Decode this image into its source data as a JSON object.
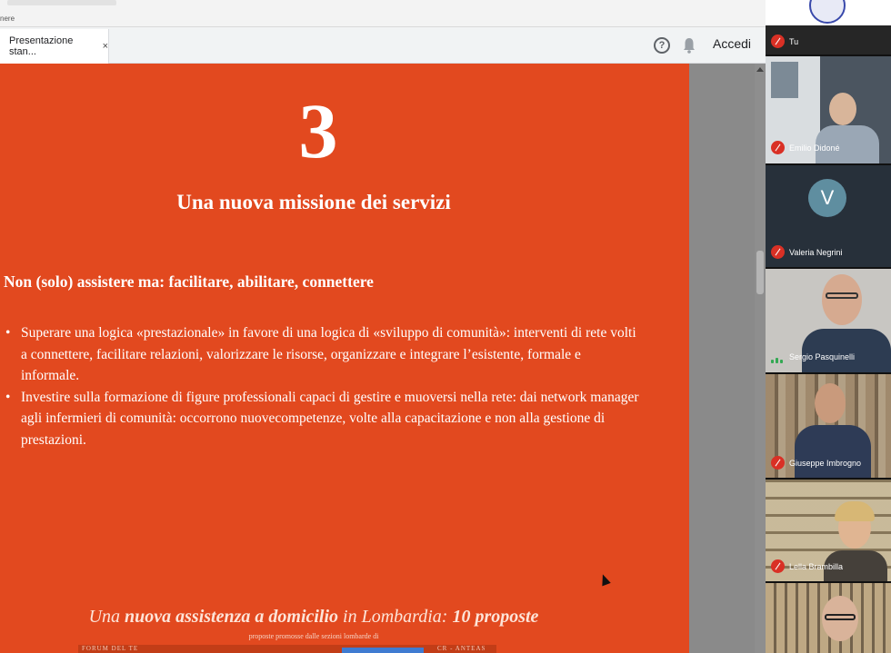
{
  "browser": {
    "menu_text": "nere"
  },
  "tab": {
    "title": "Presentazione stan...",
    "close": "×"
  },
  "toolbar": {
    "help_icon": "help-circle-icon",
    "bell_icon": "bell-icon",
    "signin_label": "Accedi"
  },
  "slide": {
    "number": "3",
    "title": "Una nuova missione dei servizi",
    "subtitle": "Non (solo) assistere ma: facilitare, abilitare, connettere",
    "bullets": [
      "Superare una logica «prestazionale» in favore di una logica di «sviluppo di comunità»: interventi di rete volti a connettere, facilitare relazioni, valorizzare le risorse, organizzare e integrare l’esistente, formale e informale.",
      "Investire sulla formazione di figure professionali capaci di gestire e muoversi nella rete: dai network manager agli infermieri di comunità: occorrono nuovecompetenze, volte alla capacitazione e non alla gestione di prestazioni."
    ],
    "footer": {
      "part1": "Una ",
      "part2": "nuova assistenza a domicilio",
      "part3": " in Lombardia: ",
      "part4": "10 proposte",
      "sub": "proposte promosse dalle sezioni lombarde di",
      "band_left": "FORUM DEL TE",
      "band_right": "CR - ANTEAS"
    }
  },
  "participants": [
    {
      "name": "Tu",
      "muted": true
    },
    {
      "name": "Emilio Didoné",
      "muted": true
    },
    {
      "name": "Valeria Negrini",
      "muted": true,
      "initial": "V"
    },
    {
      "name": "Sergio Pasquinelli",
      "muted": false
    },
    {
      "name": "Giuseppe Imbrogno",
      "muted": true
    },
    {
      "name": "Lella Brambilla",
      "muted": true
    },
    {
      "name": "",
      "muted": false
    }
  ],
  "colors": {
    "slide_bg": "#e2491f",
    "mic_off": "#d93025",
    "speaking": "#34a853"
  }
}
